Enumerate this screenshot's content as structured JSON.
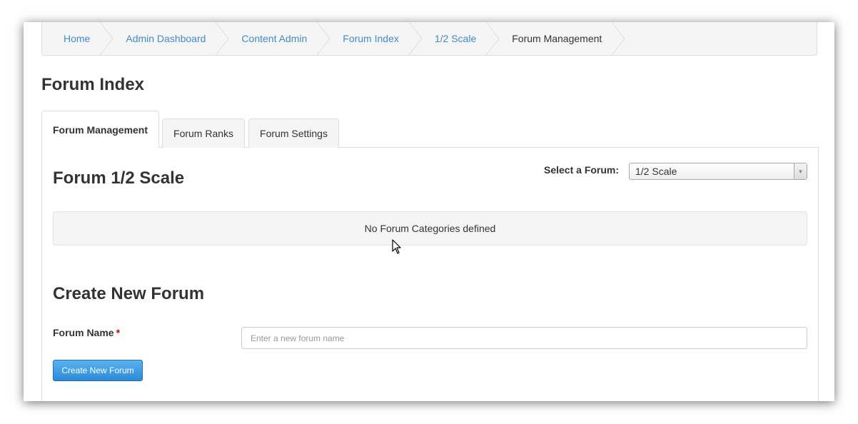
{
  "breadcrumb": {
    "items": [
      {
        "label": "Home"
      },
      {
        "label": "Admin Dashboard"
      },
      {
        "label": "Content Admin"
      },
      {
        "label": "Forum Index"
      },
      {
        "label": "1/2 Scale"
      },
      {
        "label": "Forum Management"
      }
    ]
  },
  "page_title": "Forum Index",
  "tabs": [
    {
      "label": "Forum Management",
      "active": true
    },
    {
      "label": "Forum Ranks",
      "active": false
    },
    {
      "label": "Forum Settings",
      "active": false
    }
  ],
  "forum": {
    "heading": "Forum 1/2 Scale",
    "select_label": "Select a Forum:",
    "selected": "1/2 Scale",
    "empty_message": "No Forum Categories defined"
  },
  "create": {
    "heading": "Create New Forum",
    "field_label": "Forum Name",
    "required_mark": "*",
    "placeholder": "Enter a new forum name",
    "button_label": "Create New Forum"
  },
  "colors": {
    "link": "#428bca",
    "button": "#2c8ad8",
    "required": "#cc0000"
  }
}
